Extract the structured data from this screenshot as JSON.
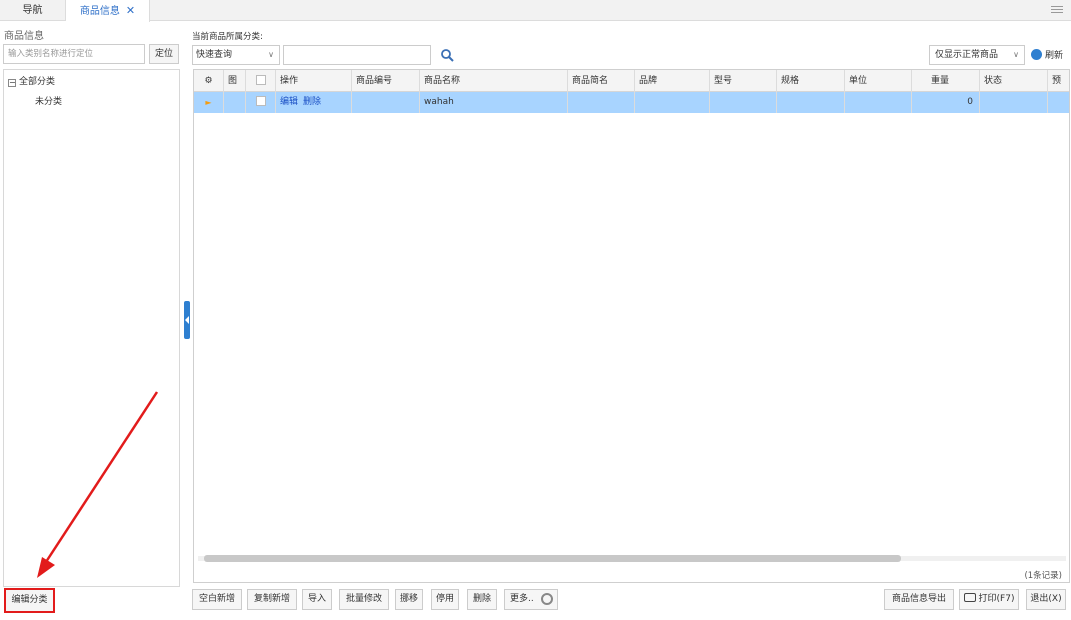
{
  "tabs": [
    {
      "label": "导航"
    },
    {
      "label": "商品信息"
    }
  ],
  "left_panel": {
    "title": "商品信息",
    "locate_placeholder": "输入类别名称进行定位",
    "locate_button": "定位",
    "tree_root": "全部分类",
    "tree_child": "未分类",
    "edit_category_button": "编辑分类"
  },
  "main": {
    "current_category_label": "当前商品所属分类:",
    "quick_search": "快速查询",
    "filter": "仅显示正常商品",
    "refresh": "刷新",
    "record_count": "(1条记录)"
  },
  "table": {
    "columns": [
      "图",
      "操作",
      "商品编号",
      "商品名称",
      "商品简名",
      "品牌",
      "型号",
      "规格",
      "单位",
      "重量",
      "状态",
      "预"
    ],
    "rows": [
      {
        "actions": [
          "编辑",
          "删除"
        ],
        "code": "",
        "name": "wahah",
        "short_name": "",
        "brand": "",
        "model": "",
        "spec": "",
        "unit": "",
        "weight": "0",
        "status": ""
      }
    ]
  },
  "bottom_buttons": {
    "blank_add": "空白新增",
    "copy_add": "复制新增",
    "import": "导入",
    "batch_edit": "批量修改",
    "move": "挪移",
    "disable": "停用",
    "delete": "删除",
    "more": "更多..",
    "export": "商品信息导出",
    "print": "打印(F7)",
    "exit": "退出(X)"
  },
  "colors": {
    "accent": "#2e6fc8",
    "selected_row": "#a8d4ff",
    "annotation_red": "#e21b1b"
  }
}
